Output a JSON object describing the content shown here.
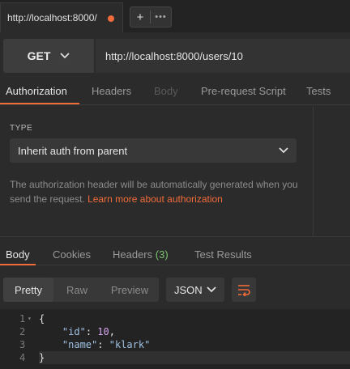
{
  "tabs": {
    "request_tab_title": "http://localhost:8000/",
    "unsaved_indicator_color": "#f26b3a",
    "plus_label": "+",
    "more_label": "•••"
  },
  "request": {
    "method": "GET",
    "url": "http://localhost:8000/users/10"
  },
  "request_tabs": [
    {
      "label": "Authorization",
      "state": "active"
    },
    {
      "label": "Headers",
      "state": "normal"
    },
    {
      "label": "Body",
      "state": "disabled"
    },
    {
      "label": "Pre-request Script",
      "state": "normal"
    },
    {
      "label": "Tests",
      "state": "normal"
    }
  ],
  "auth": {
    "type_label": "TYPE",
    "type_value": "Inherit auth from parent",
    "description": "The authorization header will be automatically generated when you send the request.",
    "learn_more_link": "Learn more about authorization"
  },
  "response_tabs": [
    {
      "label": "Body",
      "state": "active"
    },
    {
      "label": "Cookies",
      "state": "normal"
    },
    {
      "label": "Headers",
      "count": "(3)",
      "state": "normal"
    },
    {
      "label": "Test Results",
      "state": "normal"
    }
  ],
  "response_view": {
    "modes": [
      "Pretty",
      "Raw",
      "Preview"
    ],
    "active_mode": "Pretty",
    "format": "JSON",
    "wrap_icon": "wrap-lines-icon"
  },
  "response_body": {
    "line_numbers": [
      "1",
      "2",
      "3",
      "4"
    ],
    "lines": [
      "{",
      "    \"id\": 10,",
      "    \"name\": \"klark\"",
      "}"
    ]
  },
  "colors": {
    "accent": "#f26b3a",
    "background": "#2b2b2b",
    "count_green": "#7cc36e"
  }
}
